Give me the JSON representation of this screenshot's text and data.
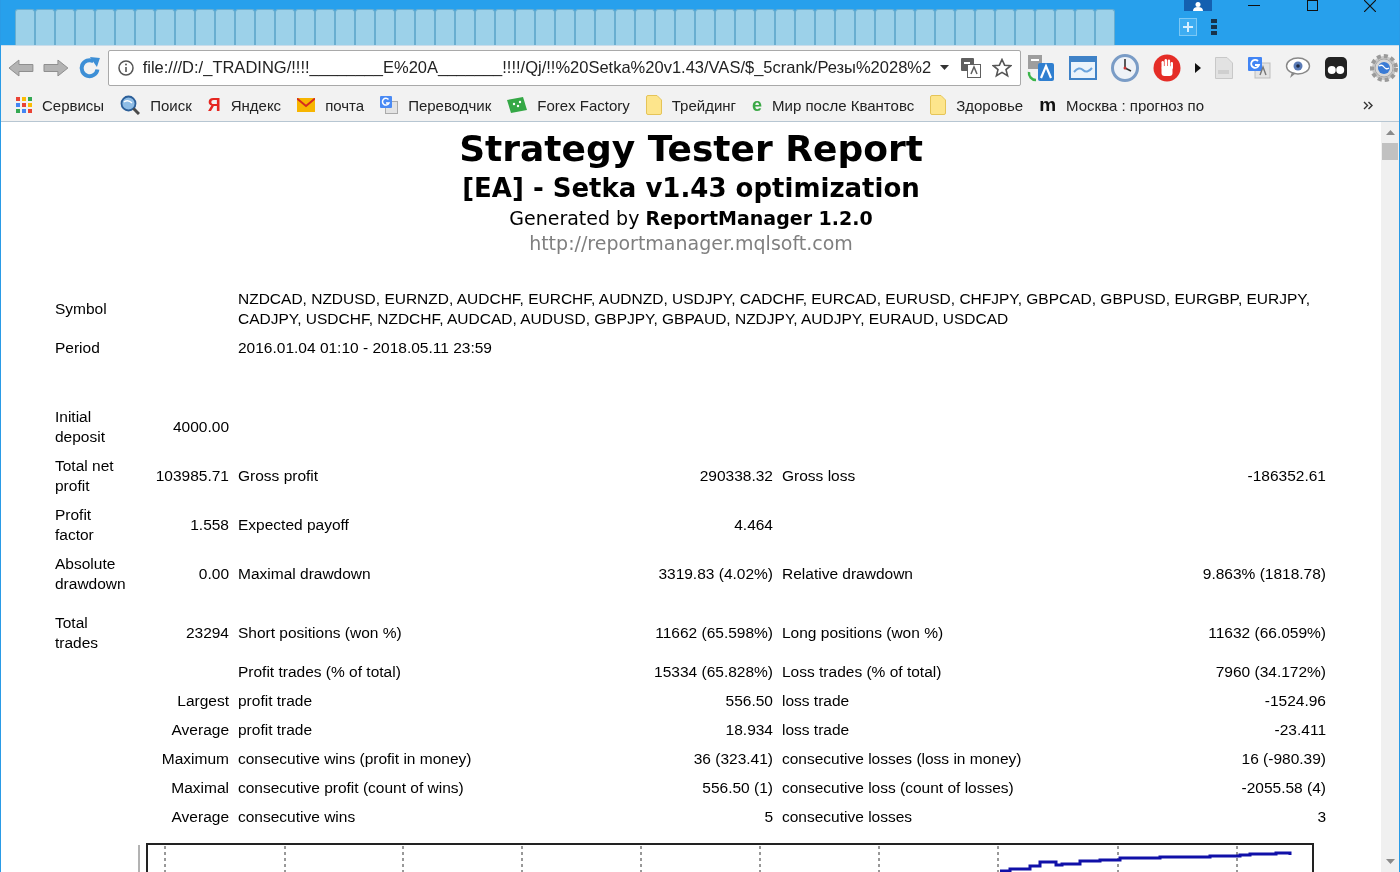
{
  "browser": {
    "address_bar": {
      "value": "file:///D:/_TRADING/!!!!________E%20A_______!!!!/Qj/!!%20Setka%20v1.43/VAS/$_5crank/Резы%2028%2"
    },
    "bookmarks": [
      {
        "label": "Сервисы"
      },
      {
        "label": "Поиск"
      },
      {
        "label": "Яндекс",
        "glyph": "Я"
      },
      {
        "label": "почта"
      },
      {
        "label": "Переводчик"
      },
      {
        "label": "Forex Factory"
      },
      {
        "label": "Трейдинг"
      },
      {
        "label": "Мир после Квантовс",
        "glyph": "e"
      },
      {
        "label": "Здоровье"
      },
      {
        "label": "Москва : прогноз по",
        "glyph": "m"
      }
    ]
  },
  "report": {
    "title": "Strategy Tester Report",
    "subtitle": "[EA] - Setka v1.43 optimization",
    "generator": "Generated by **ReportManager 1.2.0**",
    "link": "http://reportmanager.mqlsoft.com"
  },
  "summary": [
    {
      "label": "Symbol",
      "value": "NZDCAD, NZDUSD, EURNZD, AUDCHF, EURCHF, AUDNZD, USDJPY, CADCHF, EURCAD, EURUSD, CHFJPY, GBPCAD, GBPUSD, EURGBP, EURJPY, CADJPY, USDCHF, NZDCHF, AUDCAD, AUDUSD, GBPJPY, GBPAUD, NZDJPY, AUDJPY, EURAUD, USDCAD"
    },
    {
      "label": "Period",
      "value": "2016.01.04 01:10 - 2018.05.11 23:59"
    }
  ],
  "stat_groups": [
    {
      "rows": [
        {
          "kind": "main",
          "label": "Initial deposit",
          "value": "4000.00"
        },
        {
          "kind": "main",
          "label": "Total net profit",
          "value": "103985.71",
          "pairs": [
            {
              "label": "Gross profit",
              "value": "290338.32"
            },
            {
              "label": "Gross loss",
              "value": "-186352.61"
            }
          ]
        },
        {
          "kind": "main",
          "label": "Profit factor",
          "value": "1.558",
          "pairs": [
            {
              "label": "Expected payoff",
              "value": "4.464"
            }
          ]
        },
        {
          "kind": "main",
          "label": "Absolute drawdown",
          "value": "0.00",
          "pairs": [
            {
              "label": "Maximal drawdown",
              "value": "3319.83 (4.02%)"
            },
            {
              "label": "Relative drawdown",
              "value": "9.863% (1818.78)"
            }
          ]
        }
      ]
    },
    {
      "rows": [
        {
          "kind": "main",
          "label": "Total trades",
          "value": "23294",
          "pairs": [
            {
              "label": "Short positions (won %)",
              "value": "11662 (65.598%)"
            },
            {
              "label": "Long positions (won %)",
              "value": "11632 (66.059%)"
            }
          ]
        },
        {
          "kind": "detail",
          "pairs": [
            {
              "label": "Profit trades (% of total)",
              "value": "15334 (65.828%)"
            },
            {
              "label": "Loss trades (% of total)",
              "value": "7960 (34.172%)"
            }
          ]
        },
        {
          "kind": "detail",
          "prefix": "Largest",
          "pairs": [
            {
              "label": "profit trade",
              "value": "556.50"
            },
            {
              "label": "loss trade",
              "value": "-1524.96"
            }
          ]
        },
        {
          "kind": "detail",
          "prefix": "Average",
          "pairs": [
            {
              "label": "profit trade",
              "value": "18.934"
            },
            {
              "label": "loss trade",
              "value": "-23.411"
            }
          ]
        },
        {
          "kind": "detail",
          "prefix": "Maximum",
          "pairs": [
            {
              "label": "consecutive wins (profit in money)",
              "value": "36 (323.41)"
            },
            {
              "label": "consecutive losses (loss in money)",
              "value": "16 (-980.39)"
            }
          ]
        },
        {
          "kind": "detail",
          "prefix": "Maximal",
          "pairs": [
            {
              "label": "consecutive profit (count of wins)",
              "value": "556.50 (1)"
            },
            {
              "label": "consecutive loss (count of losses)",
              "value": "-2055.58 (4)"
            }
          ]
        },
        {
          "kind": "detail",
          "prefix": "Average",
          "pairs": [
            {
              "label": "consecutive wins",
              "value": "5"
            },
            {
              "label": "consecutive losses",
              "value": "3"
            }
          ]
        }
      ]
    }
  ]
}
